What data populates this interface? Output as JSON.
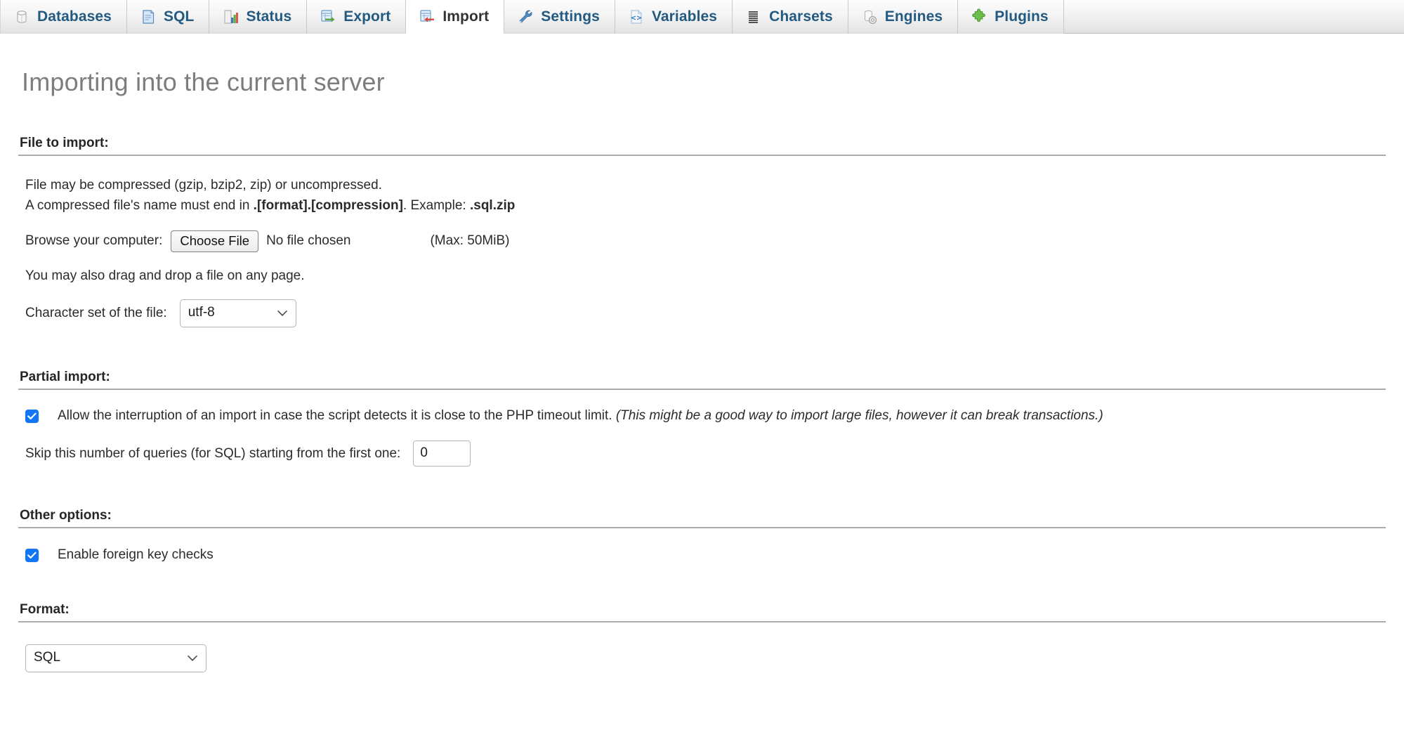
{
  "tabs": [
    {
      "label": "Databases",
      "icon": "database-icon",
      "active": false
    },
    {
      "label": "SQL",
      "icon": "sql-document-icon",
      "active": false
    },
    {
      "label": "Status",
      "icon": "status-chart-icon",
      "active": false
    },
    {
      "label": "Export",
      "icon": "export-icon",
      "active": false
    },
    {
      "label": "Import",
      "icon": "import-icon",
      "active": true
    },
    {
      "label": "Settings",
      "icon": "wrench-icon",
      "active": false
    },
    {
      "label": "Variables",
      "icon": "code-file-icon",
      "active": false
    },
    {
      "label": "Charsets",
      "icon": "charsets-icon",
      "active": false
    },
    {
      "label": "Engines",
      "icon": "engines-icon",
      "active": false
    },
    {
      "label": "Plugins",
      "icon": "puzzle-icon",
      "active": false
    }
  ],
  "page": {
    "title": "Importing into the current server"
  },
  "file_section": {
    "heading": "File to import:",
    "note_line1": "File may be compressed (gzip, bzip2, zip) or uncompressed.",
    "note_line2_prefix": "A compressed file's name must end in ",
    "note_line2_bold1": ".[format].[compression]",
    "note_line2_middle": ". Example: ",
    "note_line2_bold2": ".sql.zip",
    "browse_label": "Browse your computer:",
    "choose_file_button": "Choose File",
    "no_file_chosen": "No file chosen",
    "max_size": "(Max: 50MiB)",
    "drag_drop_note": "You may also drag and drop a file on any page.",
    "charset_label": "Character set of the file:",
    "charset_value": "utf-8",
    "charset_options": [
      "utf-8"
    ]
  },
  "partial_section": {
    "heading": "Partial import:",
    "allow_interruption_checked": true,
    "allow_interruption_label": "Allow the interruption of an import in case the script detects it is close to the PHP timeout limit.",
    "allow_interruption_note": "(This might be a good way to import large files, however it can break transactions.)",
    "skip_label": "Skip this number of queries (for SQL) starting from the first one:",
    "skip_value": "0"
  },
  "other_section": {
    "heading": "Other options:",
    "fk_checks_checked": true,
    "fk_checks_label": "Enable foreign key checks"
  },
  "format_section": {
    "heading": "Format:",
    "format_value": "SQL",
    "format_options": [
      "SQL"
    ]
  },
  "colors": {
    "tab_link": "#235a81",
    "tab_active_text": "#333333",
    "title_gray": "#7d7d7d",
    "checkbox_blue": "#1076f5",
    "rule_gray": "#aaaaaa"
  }
}
